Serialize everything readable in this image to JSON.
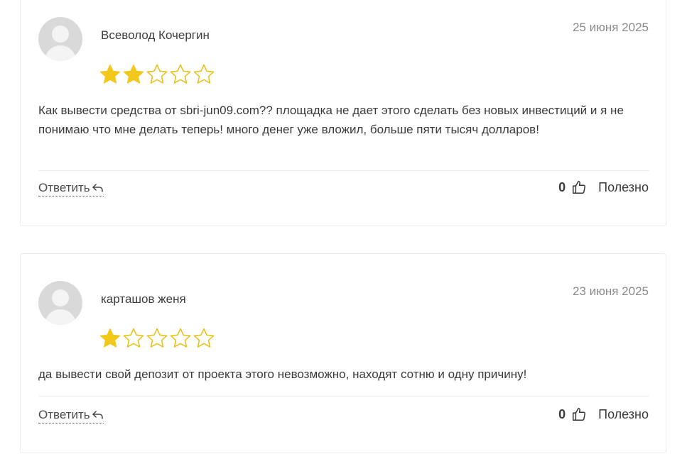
{
  "colors": {
    "star_filled": "#f2c81a",
    "star_empty_stroke": "#e8c21e",
    "avatar_bg": "#d9d9d9",
    "card_border": "#ececec",
    "date_text": "#8a8a8a"
  },
  "icons": {
    "star": "star-icon",
    "reply": "reply-arrow-icon",
    "like": "thumbs-up-icon",
    "avatar": "user-placeholder-icon"
  },
  "reviews": [
    {
      "author": "Всеволод Кочергин",
      "date": "25 июня 2025",
      "rating": 2,
      "max_rating": 5,
      "text": "Как вывести средства от sbri-jun09.com?? площадка не дает этого сделать без новых инвестиций и я не понимаю что мне делать теперь! много денег уже вложил, больше пяти тысяч долларов!",
      "reply_label": "Ответить",
      "helpful_count": "0",
      "helpful_label": "Полезно"
    },
    {
      "author": "карташов женя",
      "date": "23 июня 2025",
      "rating": 1,
      "max_rating": 5,
      "text": "да вывести свой депозит от проекта этого невозможно, находят сотню и одну причину!",
      "reply_label": "Ответить",
      "helpful_count": "0",
      "helpful_label": "Полезно"
    }
  ]
}
